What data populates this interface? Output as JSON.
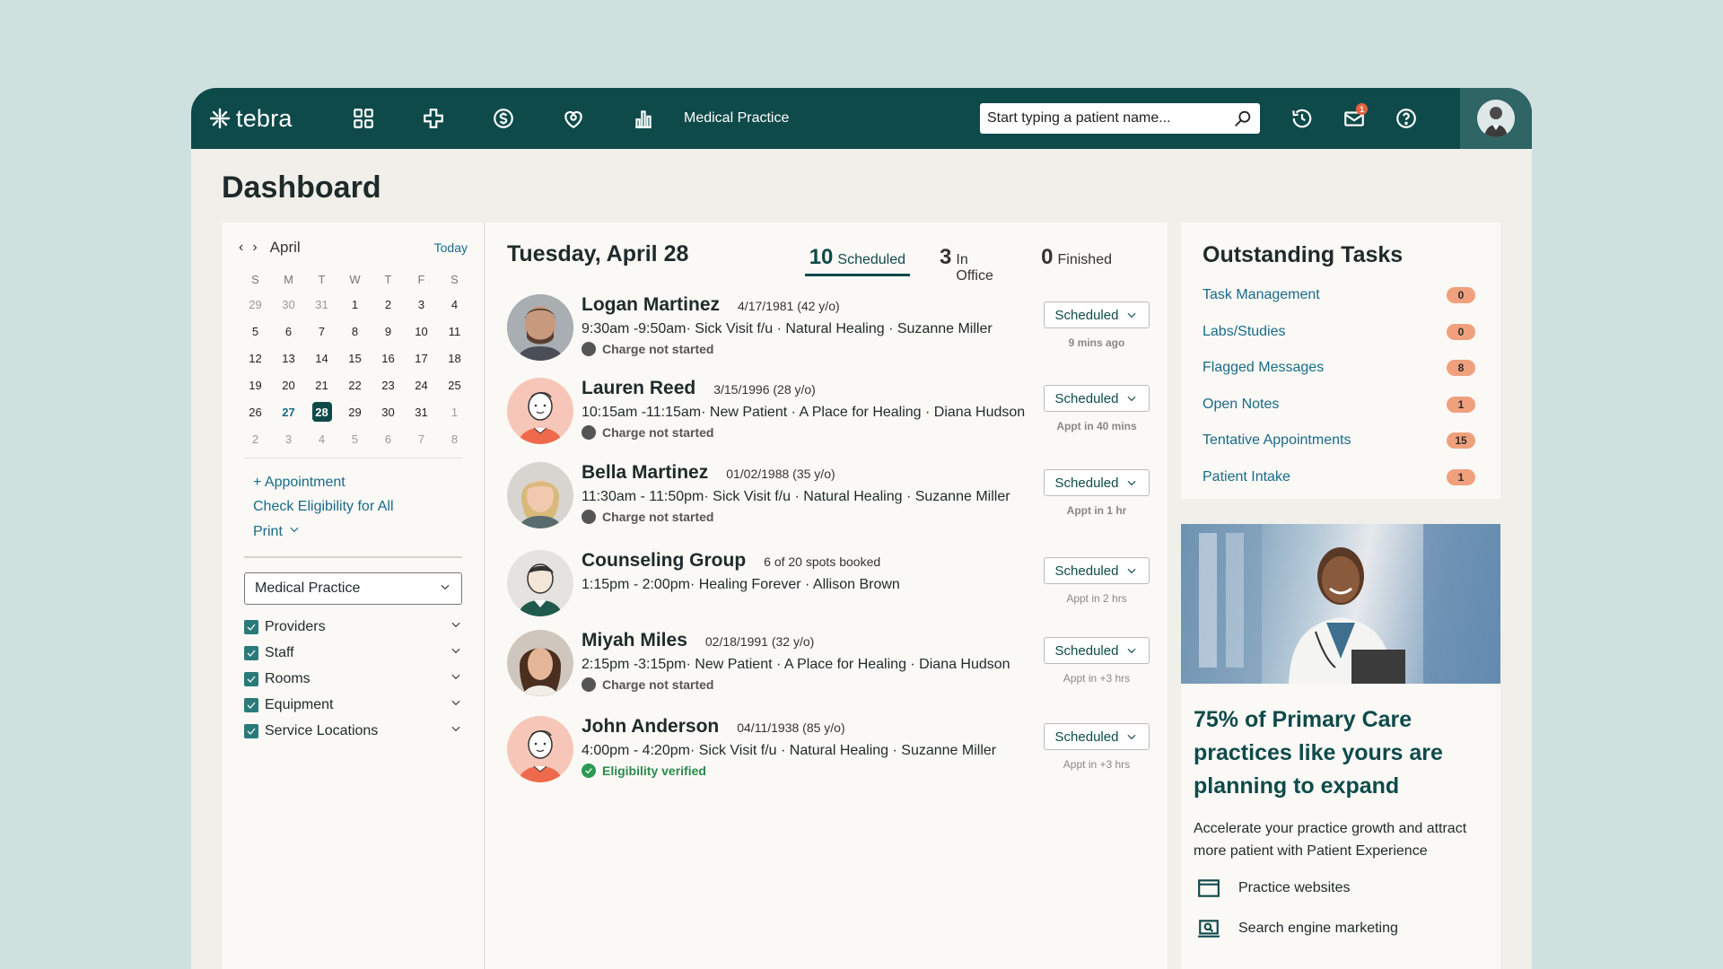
{
  "app": {
    "brand": "tebra",
    "practice_name": "Medical Practice",
    "search_placeholder": "Start typing a patient name...",
    "notification_count": "1"
  },
  "page": {
    "title": "Dashboard"
  },
  "calendar": {
    "month": "April",
    "today_label": "Today",
    "weekdays": [
      "S",
      "M",
      "T",
      "W",
      "T",
      "F",
      "S"
    ],
    "weeks": [
      [
        "29",
        "30",
        "31",
        "1",
        "2",
        "3",
        "4"
      ],
      [
        "5",
        "6",
        "7",
        "8",
        "9",
        "10",
        "11"
      ],
      [
        "12",
        "13",
        "14",
        "15",
        "16",
        "17",
        "18"
      ],
      [
        "19",
        "20",
        "21",
        "22",
        "23",
        "24",
        "25"
      ],
      [
        "26",
        "27",
        "28",
        "29",
        "30",
        "31",
        "1"
      ],
      [
        "2",
        "3",
        "4",
        "5",
        "6",
        "7",
        "8"
      ]
    ],
    "today": "27",
    "selected": "28"
  },
  "left_actions": {
    "add_appointment": "+ Appointment",
    "check_eligibility": "Check Eligibility for All",
    "print": "Print"
  },
  "filters": {
    "practice_select": "Medical Practice",
    "items": [
      {
        "label": "Providers",
        "checked": true
      },
      {
        "label": "Staff",
        "checked": true
      },
      {
        "label": "Rooms",
        "checked": true
      },
      {
        "label": "Equipment",
        "checked": true
      },
      {
        "label": "Service Locations",
        "checked": true
      }
    ]
  },
  "schedule": {
    "date_title": "Tuesday, April 28",
    "stats": [
      {
        "count": "10",
        "label": "Scheduled"
      },
      {
        "count": "3",
        "label": "In Office"
      },
      {
        "count": "0",
        "label": "Finished"
      }
    ],
    "appointments": [
      {
        "name": "Logan Martinez",
        "dob": "4/17/1981 (42 y/o)",
        "details": "9:30am -9:50am· Sick Visit f/u · Natural Healing · Suzanne Miller",
        "charge": "Charge not started",
        "status": "Scheduled",
        "when": "9 mins ago",
        "when_style": "red",
        "photo": "photo-man"
      },
      {
        "name": "Lauren Reed",
        "dob": "3/15/1996 (28 y/o)",
        "details": "10:15am -11:15am· New Patient · A Place for Healing · Diana Hudson",
        "charge": "Charge not started",
        "status": "Scheduled",
        "when": "Appt in 40 mins",
        "when_style": "green",
        "photo": "illustration"
      },
      {
        "name": "Bella Martinez",
        "dob": "01/02/1988 (35 y/o)",
        "details": "11:30am - 11:50pm· Sick Visit f/u · Natural Healing · Suzanne Miller",
        "charge": "Charge not started",
        "status": "Scheduled",
        "when": "Appt in 1 hr",
        "when_style": "green",
        "photo": "photo-woman-blonde"
      },
      {
        "name": "Counseling Group",
        "dob": "6 of 20 spots booked",
        "details": "1:15pm - 2:00pm· Healing Forever · Allison Brown",
        "charge": "",
        "status": "Scheduled",
        "when": "Appt in 2 hrs",
        "when_style": "grey",
        "photo": "illustration-green"
      },
      {
        "name": "Miyah Miles",
        "dob": "02/18/1991 (32 y/o)",
        "details": "2:15pm -3:15pm· New Patient · A Place for Healing · Diana Hudson",
        "charge": "Charge not started",
        "status": "Scheduled",
        "when": "Appt in +3 hrs",
        "when_style": "grey",
        "photo": "photo-woman-brunette"
      },
      {
        "name": "John Anderson",
        "dob": "04/11/1938 (85 y/o)",
        "details": "4:00pm - 4:20pm· Sick Visit f/u · Natural Healing · Suzanne Miller",
        "charge": "Eligibility verified",
        "charge_ok": true,
        "status": "Scheduled",
        "when": "Appt in +3 hrs",
        "when_style": "grey",
        "photo": "illustration"
      }
    ]
  },
  "tasks": {
    "title": "Outstanding Tasks",
    "items": [
      {
        "label": "Task Management",
        "count": "0"
      },
      {
        "label": "Labs/Studies",
        "count": "0"
      },
      {
        "label": "Flagged Messages",
        "count": "8"
      },
      {
        "label": "Open Notes",
        "count": "1"
      },
      {
        "label": "Tentative Appointments",
        "count": "15"
      },
      {
        "label": "Patient Intake",
        "count": "1"
      }
    ]
  },
  "promo": {
    "title": "75% of Primary Care practices like yours are planning to expand",
    "text": "Accelerate your practice growth and attract more patient with Patient Experience",
    "items": [
      {
        "label": "Practice websites",
        "icon": "browser-window-icon"
      },
      {
        "label": "Search engine marketing",
        "icon": "laptop-search-icon"
      }
    ]
  },
  "colors": {
    "brand_dark": "#0f4a4a",
    "link": "#1a6a87",
    "badge": "#f0a07d",
    "alert_red": "#c0303a",
    "ok_green": "#2a8a4a",
    "background": "#cfe1df"
  }
}
